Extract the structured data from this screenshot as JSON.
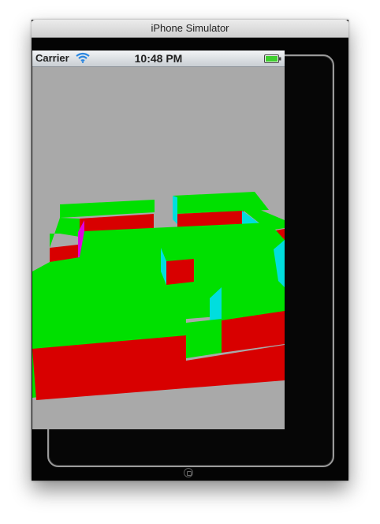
{
  "window": {
    "title": "iPhone Simulator"
  },
  "status_bar": {
    "carrier": "Carrier",
    "time": "10:48 PM",
    "wifi_icon": "wifi-icon",
    "battery_icon": "battery-icon"
  },
  "scene": {
    "description_icon": "3d-maze-view",
    "colors": {
      "background": "#a9a9a9",
      "floor_top": "#00e000",
      "wall_red": "#d80000",
      "wall_cyan": "#00dede",
      "wall_magenta": "#e000e0"
    }
  }
}
